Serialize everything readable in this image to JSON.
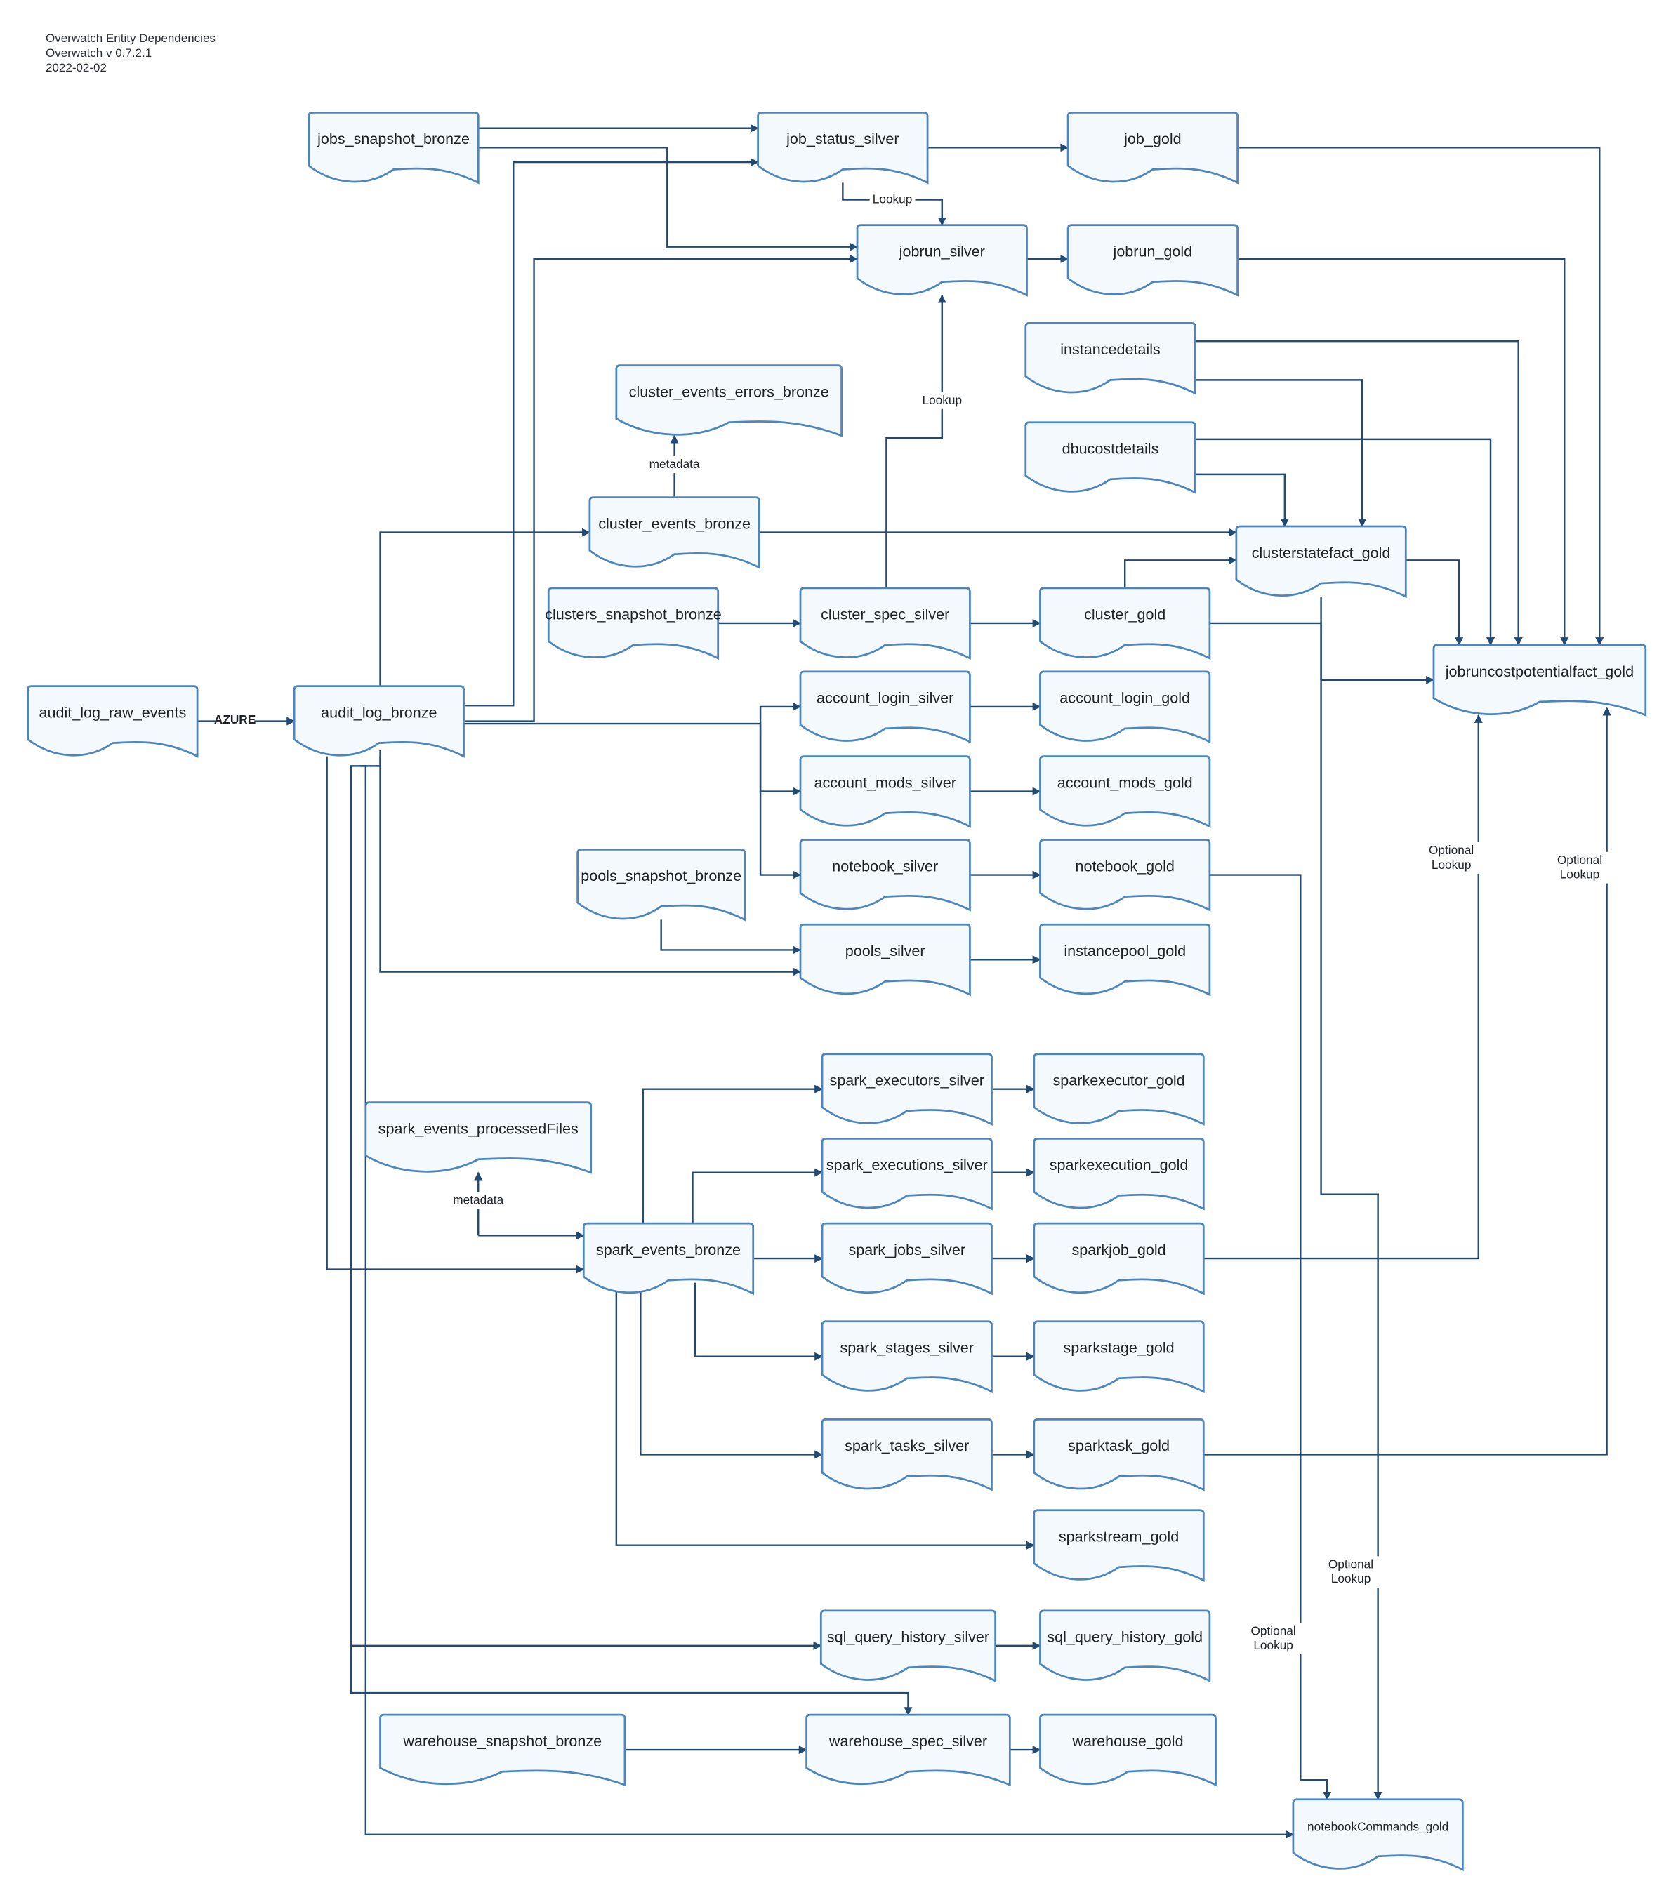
{
  "header": {
    "title": "Overwatch Entity Dependencies",
    "version": "Overwatch v 0.7.2.1",
    "date": "2022-02-02"
  },
  "colors": {
    "node_fill": "#f4f9fd",
    "node_stroke": "#4d86bd",
    "edge": "#234a70",
    "text": "#1f2328"
  },
  "nodes": {
    "jobs_snapshot_bronze": "jobs_snapshot_bronze",
    "job_status_silver": "job_status_silver",
    "job_gold": "job_gold",
    "jobrun_silver": "jobrun_silver",
    "jobrun_gold": "jobrun_gold",
    "instancedetails": "instancedetails",
    "dbucostdetails": "dbucostdetails",
    "cluster_events_errors_bronze": "cluster_events_errors_bronze",
    "cluster_events_bronze": "cluster_events_bronze",
    "clusterstatefact_gold": "clusterstatefact_gold",
    "clusters_snapshot_bronze": "clusters_snapshot_bronze",
    "cluster_spec_silver": "cluster_spec_silver",
    "cluster_gold": "cluster_gold",
    "jobruncostpotentialfact_gold": "jobruncostpotentialfact_gold",
    "audit_log_raw_events": "audit_log_raw_events",
    "audit_log_bronze": "audit_log_bronze",
    "account_login_silver": "account_login_silver",
    "account_login_gold": "account_login_gold",
    "account_mods_silver": "account_mods_silver",
    "account_mods_gold": "account_mods_gold",
    "pools_snapshot_bronze": "pools_snapshot_bronze",
    "notebook_silver": "notebook_silver",
    "notebook_gold": "notebook_gold",
    "pools_silver": "pools_silver",
    "instancepool_gold": "instancepool_gold",
    "spark_events_processedFiles": "spark_events_processedFiles",
    "spark_executors_silver": "spark_executors_silver",
    "sparkexecutor_gold": "sparkexecutor_gold",
    "spark_executions_silver": "spark_executions_silver",
    "sparkexecution_gold": "sparkexecution_gold",
    "spark_events_bronze": "spark_events_bronze",
    "spark_jobs_silver": "spark_jobs_silver",
    "sparkjob_gold": "sparkjob_gold",
    "spark_stages_silver": "spark_stages_silver",
    "sparkstage_gold": "sparkstage_gold",
    "spark_tasks_silver": "spark_tasks_silver",
    "sparktask_gold": "sparktask_gold",
    "sparkstream_gold": "sparkstream_gold",
    "sql_query_history_silver": "sql_query_history_silver",
    "sql_query_history_gold": "sql_query_history_gold",
    "warehouse_snapshot_bronze": "warehouse_snapshot_bronze",
    "warehouse_spec_silver": "warehouse_spec_silver",
    "warehouse_gold": "warehouse_gold",
    "notebookCommands_gold": "notebookCommands_gold"
  },
  "edge_labels": {
    "azure": "AZURE",
    "lookup_job_status": "Lookup",
    "lookup_cluster_spec": "Lookup",
    "metadata_cluster_events": "metadata",
    "metadata_spark_events": "metadata",
    "optional_lookup_sparkjob": [
      "Optional",
      "Lookup"
    ],
    "optional_lookup_sparktask": [
      "Optional",
      "Lookup"
    ],
    "optional_lookup_notebook": [
      "Optional",
      "Lookup"
    ],
    "optional_lookup_clusterstate": [
      "Optional",
      "Lookup"
    ]
  }
}
